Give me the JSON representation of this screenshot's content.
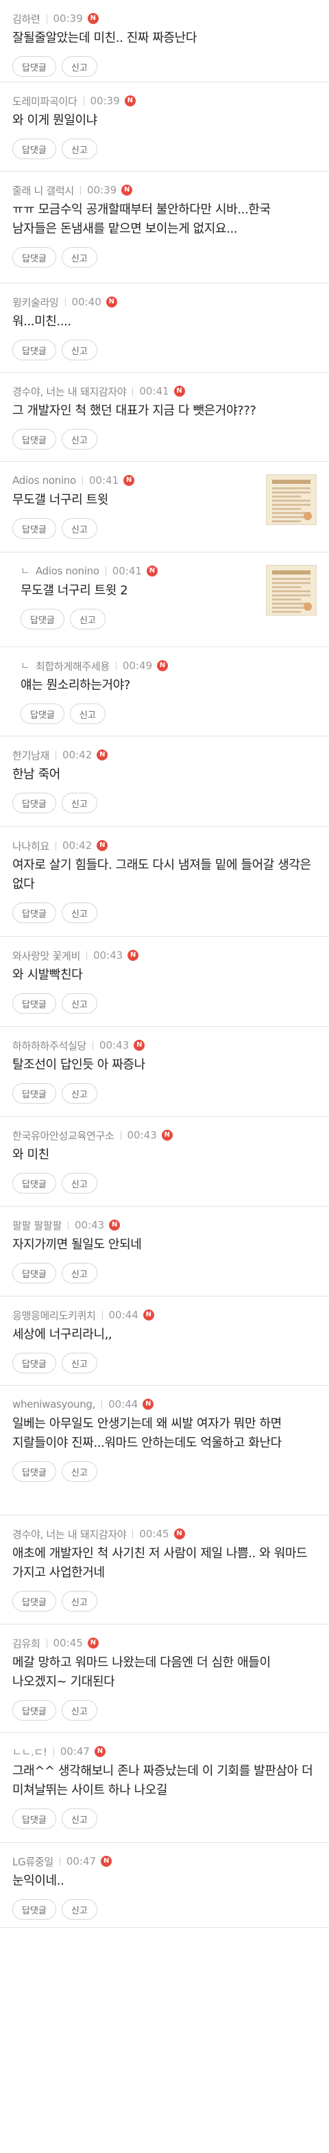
{
  "labels": {
    "reply": "답댓글",
    "report": "신고",
    "new_badge": "N",
    "reply_arrow": "ㄴ"
  },
  "colors": {
    "new_badge": "#e8493f",
    "author": "#888888",
    "border": "#e4e4e4"
  },
  "comments": [
    {
      "author": "김하련",
      "time": "00:39",
      "text": "잘될줄알았는데 미친.. 진짜 짜증난다",
      "reply": false,
      "thumb": false,
      "h": 120
    },
    {
      "author": "도레미파곡이다",
      "time": "00:39",
      "text": "와 이게 뭔일이냐",
      "reply": false,
      "thumb": false,
      "h": 130
    },
    {
      "author": "줄래 니 갤럭시",
      "time": "00:39",
      "text": "ㅠㅠ 모금수익 공개할때부터 불안하다만 시바...한국 남자들은 돈냄새를 맡으면 보이는게 없지요...",
      "reply": false,
      "thumb": false,
      "h": 163
    },
    {
      "author": "윙키술라잉",
      "time": "00:40",
      "text": "워...미친....",
      "reply": false,
      "thumb": false,
      "h": 130
    },
    {
      "author": "경수야, 너는 내 돼지감자야",
      "time": "00:41",
      "text": "그 개발자인 척 했던 대표가 지금 다 뺏은거야???",
      "reply": false,
      "thumb": false,
      "h": 130
    },
    {
      "author": "Adios nonino",
      "time": "00:41",
      "text": "무도갤 너구리 트윗",
      "reply": false,
      "thumb": true,
      "h": 132
    },
    {
      "author": "Adios nonino",
      "time": "00:41",
      "text": "무도갤 너구리 트윗 2",
      "reply": true,
      "thumb": true,
      "h": 138
    },
    {
      "author": "최합하게해주세용",
      "time": "00:49",
      "text": "얘는 뭔소리하는거야?",
      "reply": true,
      "thumb": false,
      "h": 130
    },
    {
      "author": "한기남재",
      "time": "00:42",
      "text": "한남 죽어",
      "reply": false,
      "thumb": false,
      "h": 132
    },
    {
      "author": "나나히요",
      "time": "00:42",
      "text": "여자로 살기 힘들다. 그래도 다시 냄져들 밑에 들어갈 생각은 없다",
      "reply": false,
      "thumb": false,
      "h": 160
    },
    {
      "author": "와사랑맛 꽃게비",
      "time": "00:43",
      "text": "와 시발빡친다",
      "reply": false,
      "thumb": false,
      "h": 131
    },
    {
      "author": "하하하하주석실당",
      "time": "00:43",
      "text": "탈조선이 답인듯 아 짜증나",
      "reply": false,
      "thumb": false,
      "h": 131
    },
    {
      "author": "한국유아안성교육연구소",
      "time": "00:43",
      "text": "와 미친",
      "reply": false,
      "thumb": false,
      "h": 131
    },
    {
      "author": "팔팔 팔팔팔",
      "time": "00:43",
      "text": "자지가끼면 될일도 안되네",
      "reply": false,
      "thumb": false,
      "h": 131
    },
    {
      "author": "응맹응메리도키퀴치",
      "time": "00:44",
      "text": "세상에 너구리라니,,",
      "reply": false,
      "thumb": false,
      "h": 130
    },
    {
      "author": "wheniwasyoung,",
      "time": "00:44",
      "text": "일베는 아무일도 안생기는데 왜 씨발 여자가 뭐만 하면 지랄들이야 진짜...워마드 안하는데도 억울하고 화난다",
      "reply": false,
      "thumb": false,
      "h": 189
    },
    {
      "author": "경수야, 너는 내 돼지감자야",
      "time": "00:45",
      "text": "애초에 개발자인 척 사기친 저 사람이 제일 나쁨.. 와 워마드 가지고 사업한거네",
      "reply": false,
      "thumb": false,
      "h": 159
    },
    {
      "author": "김유희",
      "time": "00:45",
      "text": "메갈 망하고 워마드 나왔는데 다음엔 더 심한 애들이 나오겠지~ 기대된다",
      "reply": false,
      "thumb": false,
      "h": 158
    },
    {
      "author": "ㄴㄴ.ㄷ! ",
      "time": "00:47",
      "text": "그래^^ 생각해보니 존나 짜증났는데 이 기회를 발판삼아 더 미쳐날뛰는 사이트 하나 나오길",
      "reply": false,
      "thumb": false,
      "h": 160
    },
    {
      "author": "LG류중일",
      "time": "00:47",
      "text": "눈익이네..",
      "reply": false,
      "thumb": false,
      "h": 124
    }
  ]
}
